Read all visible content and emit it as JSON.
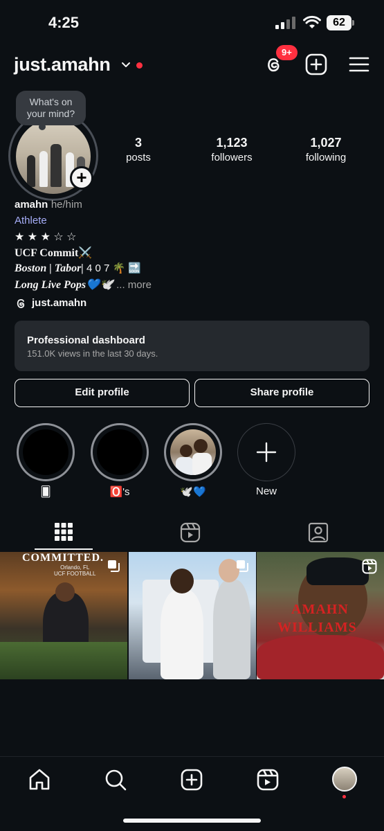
{
  "status": {
    "time": "4:25",
    "battery": "62"
  },
  "header": {
    "username": "just.amahn",
    "notification_badge": "9+"
  },
  "note": {
    "text_line1": "What's on",
    "text_line2": "your mind?"
  },
  "stats": [
    {
      "value": "3",
      "label": "posts"
    },
    {
      "value": "1,123",
      "label": "followers"
    },
    {
      "value": "1,027",
      "label": "following"
    }
  ],
  "bio": {
    "name": "amahn",
    "pronouns": "he/him",
    "category": "Athlete",
    "stars": "★ ★ ★ ☆ ☆",
    "line1": "UCF Commit⚔️",
    "line2_main": "Boston | Tabor|",
    "line2_extra": " 4 0 7 🌴 🔜",
    "line3_main": "Long Live Pops💙🕊️",
    "more": "... more"
  },
  "threads": {
    "handle": "just.amahn"
  },
  "dashboard": {
    "title": "Professional dashboard",
    "subtitle": "151.0K views in the last 30 days."
  },
  "buttons": {
    "edit": "Edit profile",
    "share": "Share profile"
  },
  "highlights": [
    {
      "label": "🂠"
    },
    {
      "label": "🅾️'s"
    },
    {
      "label": "🕊️💙"
    },
    {
      "label": "New"
    }
  ],
  "posts": [
    {
      "title": "COMMITTED.",
      "subtitle": "Orlando, FL\nUCF FOOTBALL"
    },
    {
      "title": ""
    },
    {
      "title_line1": "AMAHN",
      "title_line2": "WILLIAMS"
    }
  ]
}
